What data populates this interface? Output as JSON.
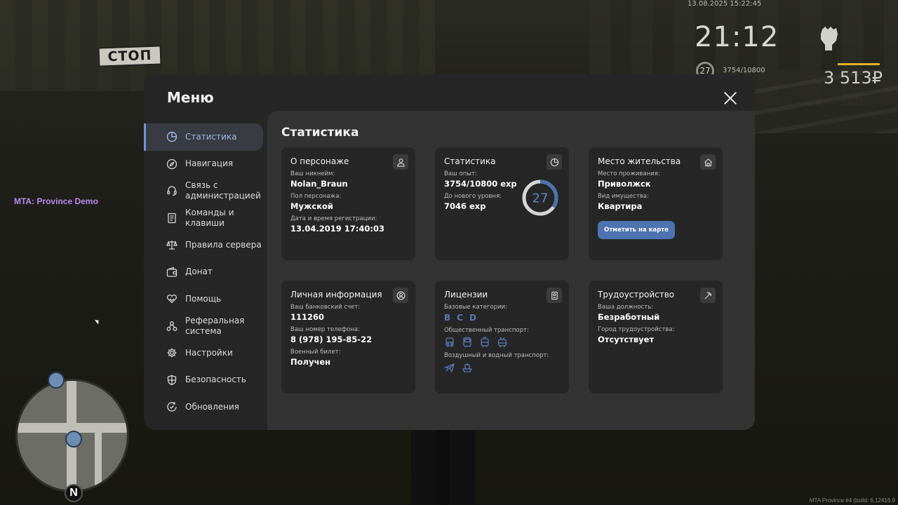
{
  "hud": {
    "datetime": "13.08.2025 15:22:45",
    "clock": "21:12",
    "level": "27",
    "exp": "3754/10800",
    "money": "3 513₽",
    "server_tag": "MTA: Province Demo",
    "build": "MTA Province #4 (build: 6.12416.9",
    "sign_text": "СТОП",
    "minimap_north": "N"
  },
  "menu": {
    "title": "Меню",
    "content_title": "Статистика",
    "sidebar": [
      {
        "label": "Статистика",
        "icon": "pie-chart-icon",
        "active": true
      },
      {
        "label": "Навигация",
        "icon": "compass-icon"
      },
      {
        "label": "Связь с администрацией",
        "icon": "headset-icon"
      },
      {
        "label": "Команды и клавиши",
        "icon": "document-icon"
      },
      {
        "label": "Правила сервера",
        "icon": "scales-icon"
      },
      {
        "label": "Донат",
        "icon": "wallet-icon"
      },
      {
        "label": "Помощь",
        "icon": "handshake-heart-icon"
      },
      {
        "label": "Реферальная система",
        "icon": "referral-icon"
      },
      {
        "label": "Настройки",
        "icon": "gear-icon"
      },
      {
        "label": "Безопасность",
        "icon": "shield-icon"
      },
      {
        "label": "Обновления",
        "icon": "refresh-check-icon"
      }
    ],
    "cards": {
      "character": {
        "title": "О персонаже",
        "nickname_label": "Ваш никнейм:",
        "nickname": "Nolan_Braun",
        "gender_label": "Пол персонажа:",
        "gender": "Мужской",
        "reg_label": "Дата и время регистрации:",
        "reg": "13.04.2019 17:40:03"
      },
      "stats": {
        "title": "Статистика",
        "exp_label": "Ваш опыт:",
        "exp": "3754/10800 exp",
        "next_label": "До нового уровня:",
        "next": "7046 exp",
        "level": "27",
        "progress": 0.3476,
        "accent_color": "#4d73b0"
      },
      "residence": {
        "title": "Место жительства",
        "place_label": "Место проживания:",
        "place": "Приволжск",
        "property_label": "Вид имущества:",
        "property": "Квартира",
        "map_button": "Отметить на карте"
      },
      "personal": {
        "title": "Личная информация",
        "bank_label": "Ваш банковский счет:",
        "bank": "111260",
        "phone_label": "Ваш номер телефона:",
        "phone": "8 (978) 195-85-22",
        "military_label": "Военный билет:",
        "military": "Получен"
      },
      "licenses": {
        "title": "Лицензии",
        "base_label": "Базовые категории:",
        "categories": [
          "B",
          "C",
          "D"
        ],
        "public_label": "Общественный транспорт:",
        "public_icons": [
          "bus-icon",
          "bus-front-icon",
          "tram-icon",
          "trolleybus-icon"
        ],
        "air_label": "Воздушный и водный транспорт:",
        "air_icons": [
          "airplane-icon",
          "boat-icon"
        ]
      },
      "job": {
        "title": "Трудоустройство",
        "position_label": "Ваша должность:",
        "position": "Безработный",
        "city_label": "Город трудоустройства:",
        "city": "Отсутствует"
      }
    }
  }
}
